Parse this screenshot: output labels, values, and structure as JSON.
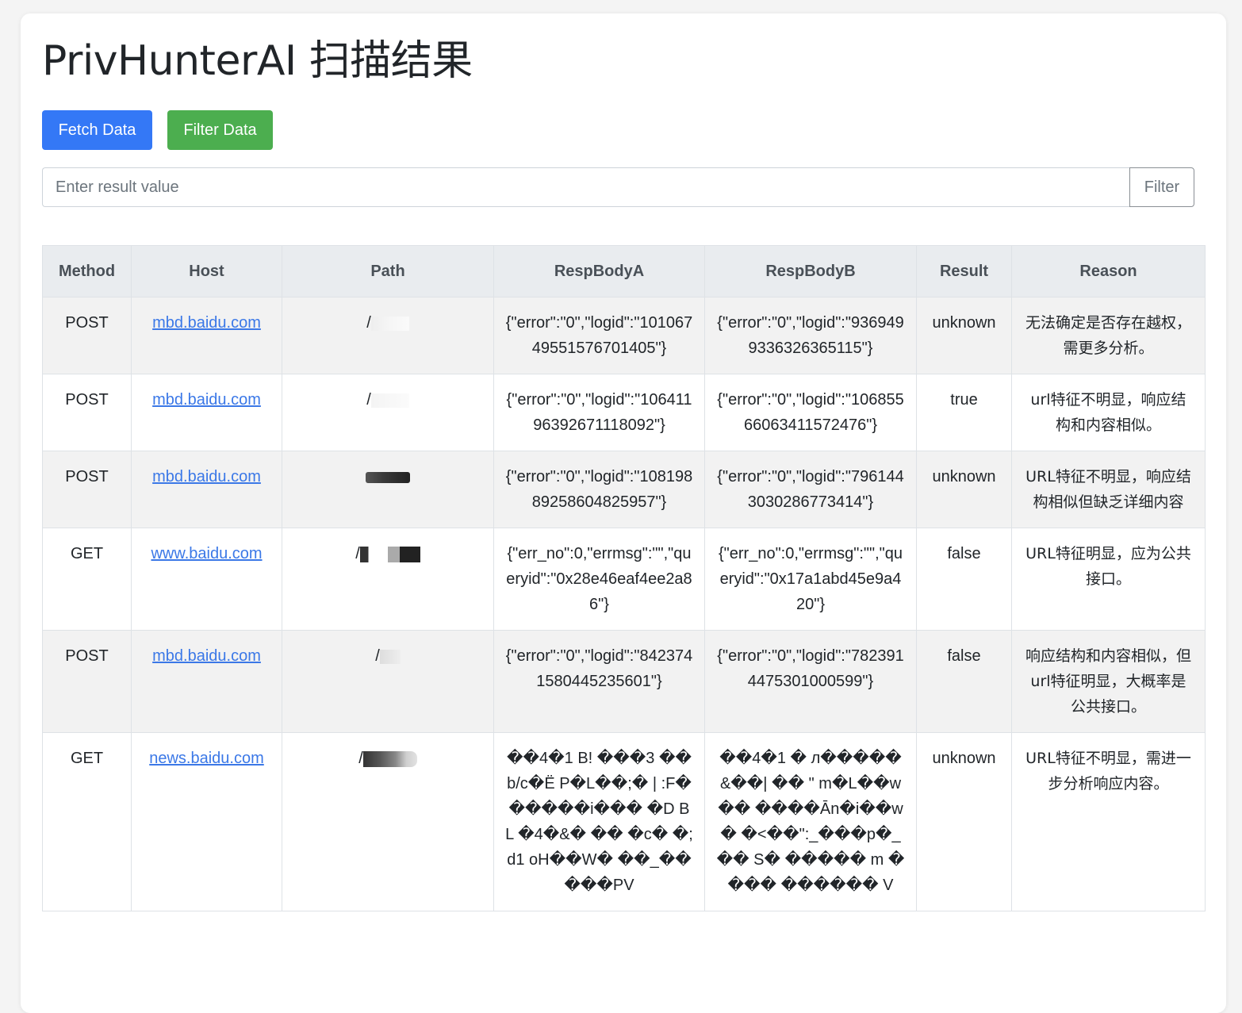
{
  "page": {
    "title": "PrivHunterAI 扫描结果"
  },
  "toolbar": {
    "fetch_label": "Fetch Data",
    "filter_label": "Filter Data"
  },
  "filter": {
    "placeholder": "Enter result value",
    "value": "",
    "button_label": "Filter"
  },
  "table": {
    "headers": [
      "Method",
      "Host",
      "Path",
      "RespBodyA",
      "RespBodyB",
      "Result",
      "Reason"
    ],
    "rows": [
      {
        "method": "POST",
        "host": "mbd.baidu.com",
        "path": "/",
        "resp_a": "{\"error\":\"0\",\"logid\":\"10106749551576701405\"}",
        "resp_b": "{\"error\":\"0\",\"logid\":\"9369499336326365115\"}",
        "result": "unknown",
        "reason": "无法确定是否存在越权，需更多分析。"
      },
      {
        "method": "POST",
        "host": "mbd.baidu.com",
        "path": "/",
        "resp_a": "{\"error\":\"0\",\"logid\":\"10641196392671118092\"}",
        "resp_b": "{\"error\":\"0\",\"logid\":\"10685566063411572476\"}",
        "result": "true",
        "reason": "url特征不明显，响应结构和内容相似。"
      },
      {
        "method": "POST",
        "host": "mbd.baidu.com",
        "path": "",
        "resp_a": "{\"error\":\"0\",\"logid\":\"10819889258604825957\"}",
        "resp_b": "{\"error\":\"0\",\"logid\":\"7961443030286773414\"}",
        "result": "unknown",
        "reason": "URL特征不明显，响应结构相似但缺乏详细内容"
      },
      {
        "method": "GET",
        "host": "www.baidu.com",
        "path": "/",
        "resp_a": "{\"err_no\":0,\"errmsg\":\"\",\"queryid\":\"0x28e46eaf4ee2a86\"}",
        "resp_b": "{\"err_no\":0,\"errmsg\":\"\",\"queryid\":\"0x17a1abd45e9a420\"}",
        "result": "false",
        "reason": "URL特征明显，应为公共接口。"
      },
      {
        "method": "POST",
        "host": "mbd.baidu.com",
        "path": "/",
        "resp_a": "{\"error\":\"0\",\"logid\":\"8423741580445235601\"}",
        "resp_b": "{\"error\":\"0\",\"logid\":\"7823914475301000599\"}",
        "result": "false",
        "reason": "响应结构和内容相似，但url特征明显，大概率是公共接口。"
      },
      {
        "method": "GET",
        "host": "news.baidu.com",
        "path": "/",
        "resp_a": "��4�1 B!  ���3 ��b/c�Ë P�L��;� | :F������i��� �D BL  �4�&� �� �c� �;d1 oH��W� ��_�����PV",
        "resp_b": "��4�1 � л�����&��| ��  \" m�L��w�� ����Ān�i��w� �<��\":_���p�_ �� S� ����� m ���� ������ V",
        "result": "unknown",
        "reason": "URL特征不明显，需进一步分析响应内容。"
      }
    ]
  },
  "colors": {
    "primary": "#3478f6",
    "success": "#4cae4f",
    "link": "#3b78e7",
    "header_bg": "#e9ecef",
    "stripe_bg": "#f2f2f2"
  }
}
